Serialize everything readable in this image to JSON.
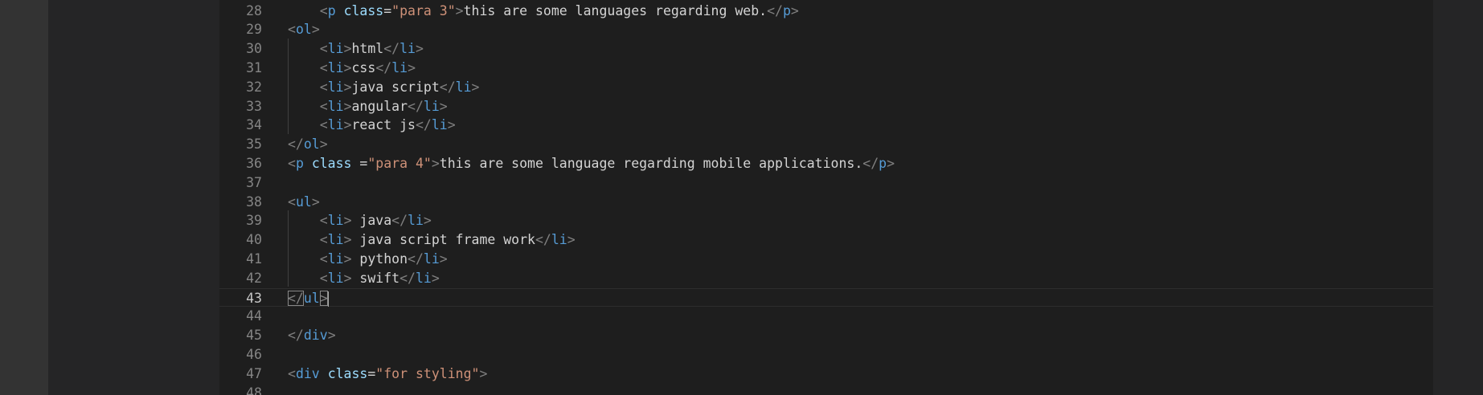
{
  "editor": {
    "current_line": "43",
    "lines": [
      {
        "num": "28",
        "indent": "    ",
        "t1": "<",
        "tag1": "p",
        "sp1": " ",
        "attr1": "class",
        "eq1": "=",
        "str1": "\"para 3\"",
        "t2": ">",
        "text1": "this are some languages regarding web.",
        "t3": "</",
        "tag2": "p",
        "t4": ">"
      },
      {
        "num": "29",
        "t1": "<",
        "tag1": "ol",
        "t2": ">"
      },
      {
        "num": "30",
        "indent": "    ",
        "t1": "<",
        "tag1": "li",
        "t2": ">",
        "text1": "html",
        "t3": "</",
        "tag2": "li",
        "t4": ">"
      },
      {
        "num": "31",
        "indent": "    ",
        "t1": "<",
        "tag1": "li",
        "t2": ">",
        "text1": "css",
        "t3": "</",
        "tag2": "li",
        "t4": ">"
      },
      {
        "num": "32",
        "indent": "    ",
        "t1": "<",
        "tag1": "li",
        "t2": ">",
        "text1": "java script",
        "t3": "</",
        "tag2": "li",
        "t4": ">"
      },
      {
        "num": "33",
        "indent": "    ",
        "t1": "<",
        "tag1": "li",
        "t2": ">",
        "text1": "angular",
        "t3": "</",
        "tag2": "li",
        "t4": ">"
      },
      {
        "num": "34",
        "indent": "    ",
        "t1": "<",
        "tag1": "li",
        "t2": ">",
        "text1": "react js",
        "t3": "</",
        "tag2": "li",
        "t4": ">"
      },
      {
        "num": "35",
        "t1": "</",
        "tag1": "ol",
        "t2": ">"
      },
      {
        "num": "36",
        "t1": "<",
        "tag1": "p",
        "sp1": " ",
        "attr1": "class",
        "eq1": " =",
        "str1": "\"para 4\"",
        "t2": ">",
        "text1": "this are some language regarding mobile applications.",
        "t3": "</",
        "tag2": "p",
        "t4": ">"
      },
      {
        "num": "37"
      },
      {
        "num": "38",
        "t1": "<",
        "tag1": "ul",
        "t2": ">"
      },
      {
        "num": "39",
        "indent": "    ",
        "t1": "<",
        "tag1": "li",
        "t2": ">",
        "text1": " java",
        "t3": "</",
        "tag2": "li",
        "t4": ">"
      },
      {
        "num": "40",
        "indent": "    ",
        "t1": "<",
        "tag1": "li",
        "t2": ">",
        "text1": " java script frame work",
        "t3": "</",
        "tag2": "li",
        "t4": ">"
      },
      {
        "num": "41",
        "indent": "    ",
        "t1": "<",
        "tag1": "li",
        "t2": ">",
        "text1": " python",
        "t3": "</",
        "tag2": "li",
        "t4": ">"
      },
      {
        "num": "42",
        "indent": "    ",
        "t1": "<",
        "tag1": "li",
        "t2": ">",
        "text1": " swift",
        "t3": "</",
        "tag2": "li",
        "t4": ">"
      },
      {
        "num": "43",
        "t1": "</",
        "tag1": "ul",
        "t2": ">"
      },
      {
        "num": "44"
      },
      {
        "num": "45",
        "t1": "</",
        "tag1": "div",
        "t2": ">"
      },
      {
        "num": "46"
      },
      {
        "num": "47",
        "t1": "<",
        "tag1": "div",
        "sp1": " ",
        "attr1": "class",
        "eq1": "=",
        "str1": "\"for styling\"",
        "t2": ">"
      },
      {
        "num": "48"
      }
    ]
  }
}
